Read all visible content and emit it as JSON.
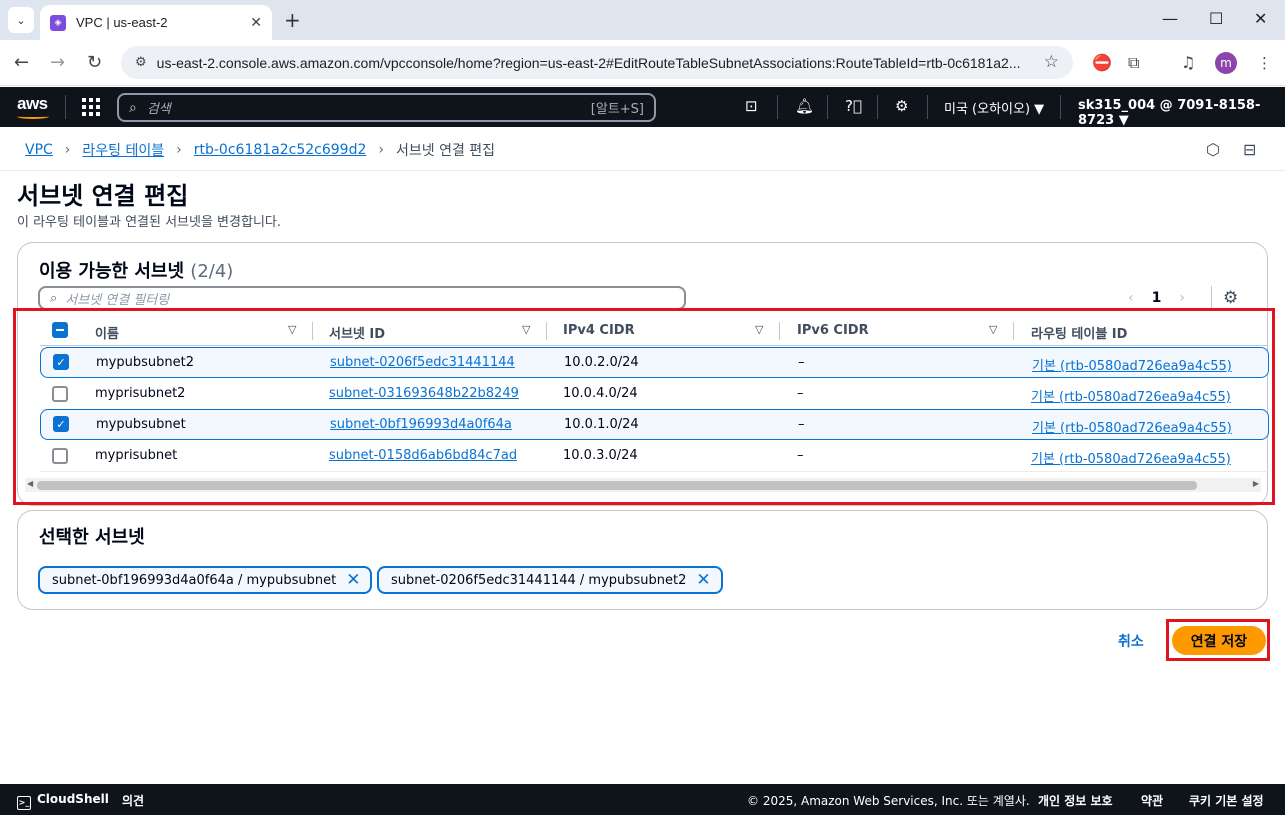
{
  "browser": {
    "tab_title": "VPC | us-east-2",
    "url": "us-east-2.console.aws.amazon.com/vpcconsole/home?region=us-east-2#EditRouteTableSubnetAssociations:RouteTableId=rtb-0c6181a2...",
    "avatar_letter": "m"
  },
  "aws_header": {
    "logo": "aws",
    "search_placeholder": "검색",
    "search_shortcut": "[알트+S]",
    "region": "미국 (오하이오) ▼",
    "account": "sk315_004 @ 7091-8158-8723 ▼"
  },
  "breadcrumb": {
    "items": [
      "VPC",
      "라우팅 테이블",
      "rtb-0c6181a2c52c699d2"
    ],
    "current": "서브넷 연결 편집"
  },
  "page": {
    "title": "서브넷 연결 편집",
    "description": "이 라우팅 테이블과 연결된 서브넷을 변경합니다."
  },
  "available": {
    "title": "이용 가능한 서브넷",
    "count": "(2/4)",
    "filter_placeholder": "서브넷 연결 필터링",
    "page": "1",
    "columns": [
      "이름",
      "서브넷 ID",
      "IPv4 CIDR",
      "IPv6 CIDR",
      "라우팅 테이블 ID"
    ],
    "rows": [
      {
        "name": "mypubsubnet2",
        "subnet_id": "subnet-0206f5edc31441144",
        "ipv4": "10.0.2.0/24",
        "ipv6": "–",
        "rtb": "기본 (rtb-0580ad726ea9a4c55)",
        "checked": true
      },
      {
        "name": "myprisubnet2",
        "subnet_id": "subnet-031693648b22b8249",
        "ipv4": "10.0.4.0/24",
        "ipv6": "–",
        "rtb": "기본 (rtb-0580ad726ea9a4c55)",
        "checked": false
      },
      {
        "name": "mypubsubnet",
        "subnet_id": "subnet-0bf196993d4a0f64a",
        "ipv4": "10.0.1.0/24",
        "ipv6": "–",
        "rtb": "기본 (rtb-0580ad726ea9a4c55)",
        "checked": true
      },
      {
        "name": "myprisubnet",
        "subnet_id": "subnet-0158d6ab6bd84c7ad",
        "ipv4": "10.0.3.0/24",
        "ipv6": "–",
        "rtb": "기본 (rtb-0580ad726ea9a4c55)",
        "checked": false
      }
    ]
  },
  "selected": {
    "title": "선택한 서브넷",
    "tokens": [
      "subnet-0bf196993d4a0f64a / mypubsubnet",
      "subnet-0206f5edc31441144 / mypubsubnet2"
    ]
  },
  "actions": {
    "cancel": "취소",
    "save": "연결 저장"
  },
  "footer": {
    "cloudshell": "CloudShell",
    "feedback": "의견",
    "copyright": "© 2025, Amazon Web Services, Inc. 또는 계열사.",
    "privacy": "개인 정보 보호",
    "terms": "약관",
    "cookies": "쿠키 기본 설정"
  },
  "colors": {
    "link": "#0972d3",
    "primary_button": "#ff9900",
    "header_bg": "#0f141a",
    "highlight_frame": "#e0141e"
  }
}
